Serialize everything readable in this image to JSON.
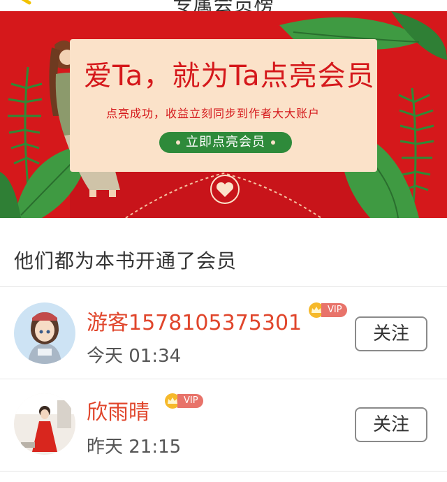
{
  "header": {
    "title": "专属会员榜",
    "back_icon": "back-arrow-icon"
  },
  "banner": {
    "headline": "爱Ta，就为Ta点亮会员",
    "subline": "点亮成功，收益立刻同步到作者大大账户",
    "cta_label": "立即点亮会员",
    "colors": {
      "background": "#d5181b",
      "card": "#fbe2c9",
      "cta": "#2e8a3a",
      "leaf": "#3f9a42"
    },
    "emblem_icon": "heart-seal-icon"
  },
  "section": {
    "title": "他们都为本书开通了会员"
  },
  "members": [
    {
      "name": "游客1578105375301",
      "vip_label": "VIP",
      "time": "今天 01:34",
      "follow_label": "关注"
    },
    {
      "name": "欣雨晴",
      "vip_label": "VIP",
      "time": "昨天 21:15",
      "follow_label": "关注"
    }
  ],
  "colors": {
    "name": "#e0452b",
    "vip_badge": "#e8736a",
    "divider": "#e6e6e6"
  }
}
